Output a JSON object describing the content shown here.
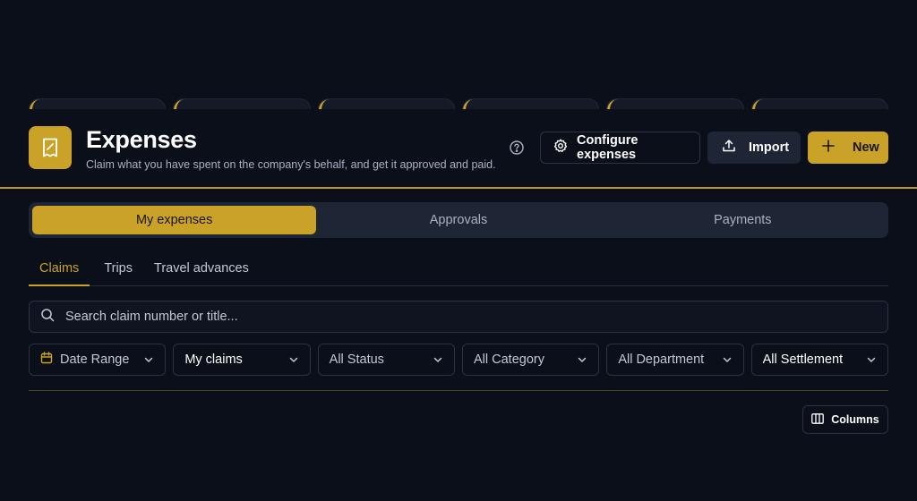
{
  "header": {
    "title": "Expenses",
    "subtitle": "Claim what you have spent on the company's behalf, and get it approved and paid.",
    "configure_label": "Configure expenses",
    "import_label": "Import",
    "new_label": "New"
  },
  "segments": [
    "My expenses",
    "Approvals",
    "Payments"
  ],
  "subtabs": [
    "Claims",
    "Trips",
    "Travel advances"
  ],
  "search": {
    "placeholder": "Search claim number or title..."
  },
  "filters": {
    "date_range": "Date Range",
    "claims": "My claims",
    "status": "All Status",
    "category": "All Category",
    "department": "All Department",
    "settlement": "All Settlement"
  },
  "columns_label": "Columns",
  "colors": {
    "accent": "#c9a227",
    "background": "#0b0f19",
    "panel": "#1e2535"
  },
  "icons": [
    "receipt-icon",
    "help-icon",
    "gear-icon",
    "upload-icon",
    "plus-icon",
    "search-icon",
    "calendar-icon",
    "chevron-down-icon",
    "columns-icon"
  ]
}
